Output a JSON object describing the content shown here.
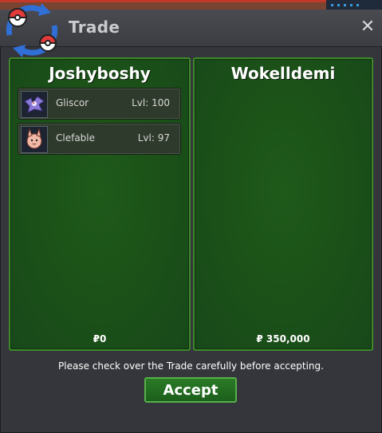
{
  "window": {
    "title": "Trade",
    "close_label": "✕"
  },
  "left_panel": {
    "player": "Joshyboshy",
    "items": [
      {
        "name": "Gliscor",
        "level": "Lvl: 100",
        "sprite_icon": "gliscor-sprite-icon"
      },
      {
        "name": "Clefable",
        "level": "Lvl: 97",
        "sprite_icon": "clefable-sprite-icon"
      }
    ],
    "money": "₽0"
  },
  "right_panel": {
    "player": "Wokelldemi",
    "items": [],
    "money": "₽ 350,000"
  },
  "footer": {
    "notice": "Please check over the Trade carefully before accepting.",
    "accept_label": "Accept"
  },
  "colors": {
    "panel": "#1c5318",
    "panel_border": "#3c8a2a",
    "window": "#35363b",
    "button": "#2b7a27"
  }
}
